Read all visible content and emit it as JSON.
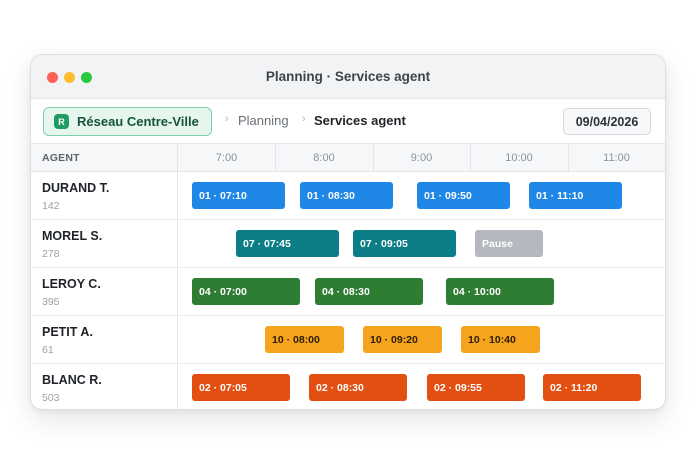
{
  "window": {
    "title": "Planning · Services agent"
  },
  "toolbar": {
    "network_icon_letter": "R",
    "network_label": "Réseau Centre-Ville",
    "breadcrumb": [
      "Planning",
      "Services agent"
    ],
    "date": "09/04/2026"
  },
  "grid": {
    "agent_header": "AGENT",
    "hours": [
      "7:00",
      "8:00",
      "9:00",
      "10:00",
      "11:00"
    ]
  },
  "agents": [
    {
      "name": "DURAND T.",
      "id": "142"
    },
    {
      "name": "MOREL S.",
      "id": "278"
    },
    {
      "name": "LEROY C.",
      "id": "395"
    },
    {
      "name": "PETIT A.",
      "id": "61"
    },
    {
      "name": "BLANC R.",
      "id": "503"
    }
  ],
  "shifts": [
    [
      {
        "label": "01 · 07:10",
        "line": "01"
      },
      {
        "label": "01 · 08:30",
        "line": "01"
      },
      {
        "label": "01 · 09:50",
        "line": "01"
      },
      {
        "label": "01 · 11:10",
        "line": "01"
      }
    ],
    [
      {
        "label": "07 · 07:45",
        "line": "07"
      },
      {
        "label": "07 · 09:05",
        "line": "07"
      },
      {
        "label": "Pause",
        "line": "pause"
      }
    ],
    [
      {
        "label": "04 · 07:00",
        "line": "04"
      },
      {
        "label": "04 · 08:30",
        "line": "04"
      },
      {
        "label": "04 · 10:00",
        "line": "04"
      }
    ],
    [
      {
        "label": "10 · 08:00",
        "line": "10"
      },
      {
        "label": "10 · 09:20",
        "line": "10"
      },
      {
        "label": "10 · 10:40",
        "line": "10"
      }
    ],
    [
      {
        "label": "02 · 07:05",
        "line": "02"
      },
      {
        "label": "02 · 08:30",
        "line": "02"
      },
      {
        "label": "02 · 09:55",
        "line": "02"
      },
      {
        "label": "02 · 11:20",
        "line": "02"
      }
    ]
  ],
  "colors": {
    "line_01": "#1f87e6",
    "line_07": "#0b7d86",
    "line_04": "#2e7d32",
    "line_10": "#f6a31e",
    "line_02": "#e24f10",
    "pause": "#b4b9bf",
    "network_accent": "#1f9b63"
  }
}
